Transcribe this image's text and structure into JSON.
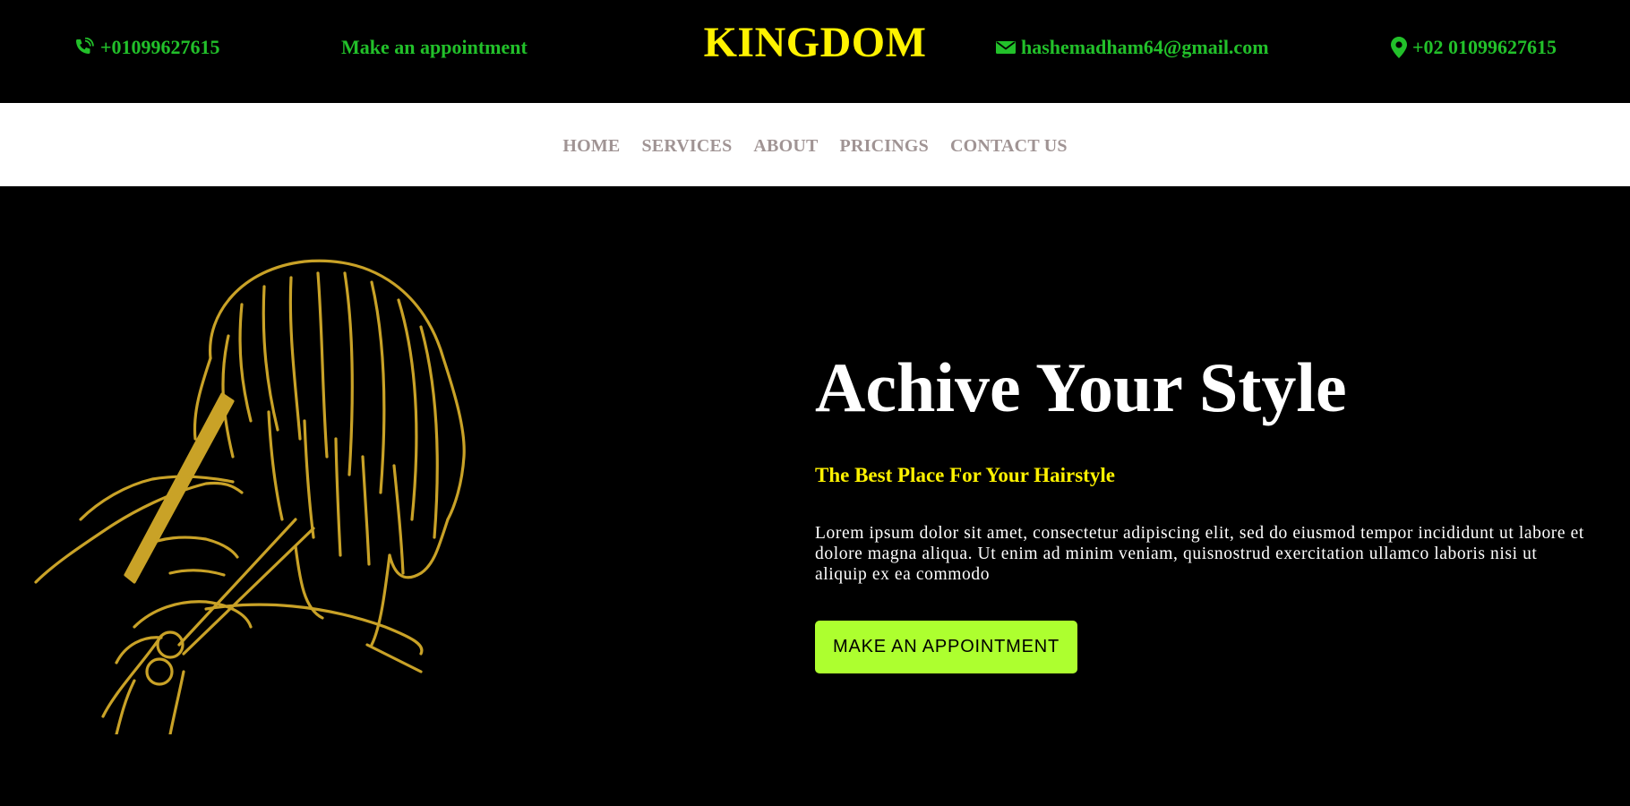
{
  "header": {
    "phone": "+01099627615",
    "appointment_link": "Make an appointment",
    "brand": "KINGDOM",
    "email": "hashemadham64@gmail.com",
    "location_phone": "+02 01099627615"
  },
  "nav": {
    "items": [
      {
        "label": "HOME"
      },
      {
        "label": "SERVICES"
      },
      {
        "label": "ABOUT"
      },
      {
        "label": "PRICINGS"
      },
      {
        "label": "CONTACT US"
      }
    ]
  },
  "hero": {
    "title": "Achive Your Style",
    "subtitle": "The Best Place For Your Hairstyle",
    "description": "Lorem ipsum dolor sit amet, consectetur adipiscing elit, sed do eiusmod tempor incididunt ut labore et dolore magna aliqua. Ut enim ad minim veniam, quisnostrud exercitation ullamco laboris nisi ut aliquip ex ea commodo",
    "cta_label": "MAKE AN APPOINTMENT",
    "illustration": "barber-haircut-illustration"
  },
  "colors": {
    "background": "#000000",
    "header_link": "#22c02a",
    "brand": "#fff200",
    "nav_text": "#a09494",
    "subtitle": "#fff200",
    "cta": "#adff2f",
    "illustration": "#c9a227"
  },
  "icons": [
    "phone-icon",
    "envelope-icon",
    "location-pin-icon"
  ]
}
